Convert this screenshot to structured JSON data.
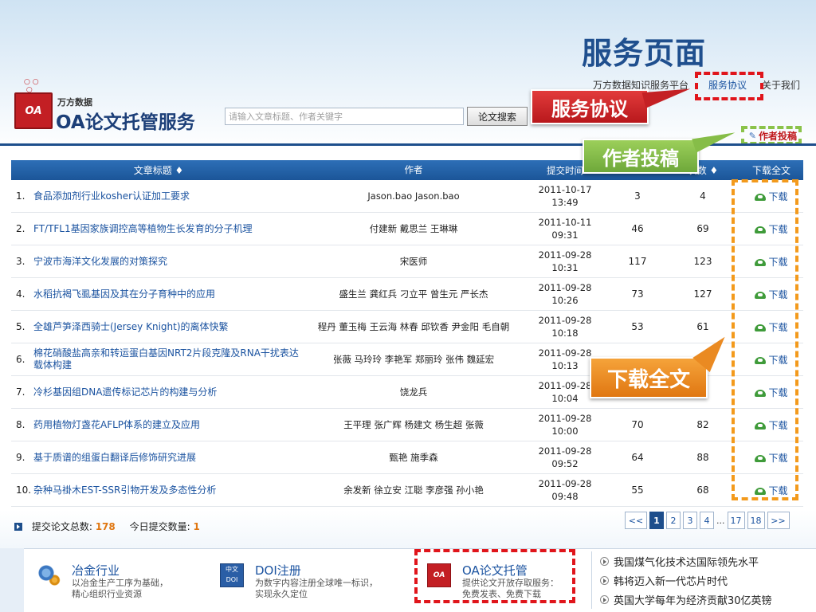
{
  "slide_title": "服务页面",
  "logo": {
    "brand": "万方数据",
    "badge": "OA",
    "name": "OA论文托管服务"
  },
  "search": {
    "placeholder": "请输入文章标题、作者关键字",
    "button_label": "论文搜索"
  },
  "top_links": {
    "platform": "万方数据知识服务平台",
    "agreement": "服务协议",
    "about": "关于我们"
  },
  "author_post_label": "作者投稿",
  "callouts": {
    "agreement": "服务协议",
    "author_post": "作者投稿",
    "download": "下载全文"
  },
  "table": {
    "headers": {
      "title": "文章标题 ♦",
      "author": "作者",
      "time": "提交时间",
      "views": "",
      "downloads": "次数 ♦",
      "download_full": "下载全文"
    },
    "download_label": "下载",
    "rows": [
      {
        "num": "1.",
        "title": "食品添加剂行业kosher认证加工要求",
        "authors": "Jason.bao  Jason.bao",
        "date": "2011-10-17",
        "time": "13:49",
        "views": "3",
        "downloads": "4"
      },
      {
        "num": "2.",
        "title": "FT/TFL1基因家族调控高等植物生长发育的分子机理",
        "authors": "付建新  戴思兰  王琳琳",
        "date": "2011-10-11",
        "time": "09:31",
        "views": "46",
        "downloads": "69"
      },
      {
        "num": "3.",
        "title": "宁波市海洋文化发展的对策探究",
        "authors": "宋医师",
        "date": "2011-09-28",
        "time": "10:31",
        "views": "117",
        "downloads": "123"
      },
      {
        "num": "4.",
        "title": "水稻抗褐飞虱基因及其在分子育种中的应用",
        "authors": "盛生兰  龚红兵  刁立平  曾生元  严长杰",
        "date": "2011-09-28",
        "time": "10:26",
        "views": "73",
        "downloads": "127"
      },
      {
        "num": "5.",
        "title": "全雄芦笋泽西骑士(Jersey Knight)的离体快繁",
        "authors": "程丹  董玉梅  王云海  林春  邱钦香  尹金阳  毛自朝",
        "date": "2011-09-28",
        "time": "10:18",
        "views": "53",
        "downloads": "61"
      },
      {
        "num": "6.",
        "title": "棉花硝酸盐高亲和转运蛋白基因NRT2片段克隆及RNA干扰表达载体构建",
        "authors": "张薇  马玲玲  李艳军  郑丽玲  张伟  魏延宏",
        "date": "2011-09-28",
        "time": "10:13",
        "views": "",
        "downloads": ""
      },
      {
        "num": "7.",
        "title": "冷杉基因组DNA遗传标记芯片的构建与分析",
        "authors": "饶龙兵",
        "date": "2011-09-28",
        "time": "10:04",
        "views": "",
        "downloads": ""
      },
      {
        "num": "8.",
        "title": "药用植物灯盏花AFLP体系的建立及应用",
        "authors": "王平理  张广辉  杨建文  杨生超  张薇",
        "date": "2011-09-28",
        "time": "10:00",
        "views": "70",
        "downloads": "82"
      },
      {
        "num": "9.",
        "title": "基于质谱的组蛋白翻译后修饰研究进展",
        "authors": "甄艳  施季森",
        "date": "2011-09-28",
        "time": "09:52",
        "views": "64",
        "downloads": "88"
      },
      {
        "num": "10.",
        "title": "杂种马褂木EST-SSR引物开发及多态性分析",
        "authors": "余发新  徐立安  江聪  李彦强  孙小艳",
        "date": "2011-09-28",
        "time": "09:48",
        "views": "55",
        "downloads": "68"
      }
    ]
  },
  "stats": {
    "total_label": "提交论文总数:",
    "total_value": "178",
    "today_label": "今日提交数量:",
    "today_value": "1"
  },
  "pagination": {
    "prev": "<<",
    "pages": [
      "1",
      "2",
      "3",
      "4"
    ],
    "ellipsis": "...",
    "tail_pages": [
      "17",
      "18"
    ],
    "next": ">>",
    "current": "1"
  },
  "services": [
    {
      "name": "冶金行业",
      "desc1": "以冶金生产工序为基础，",
      "desc2": "精心组织行业资源",
      "icon": "gear-icon"
    },
    {
      "name": "DOI注册",
      "desc1": "为数字内容注册全球唯一标识，",
      "desc2": "实现永久定位",
      "icon": "doi-icon",
      "icon_text": "中文 DOI"
    },
    {
      "name": "OA论文托管",
      "desc1": "提供论文开放存取服务：",
      "desc2": "免费发表、免费下载",
      "icon": "oa-icon",
      "icon_text": "OA"
    }
  ],
  "news": [
    "我国煤气化技术达国际领先水平",
    "韩将迈入新一代芯片时代",
    "英国大学每年为经济贡献30亿英镑"
  ],
  "colors": {
    "brand_blue": "#1d4e8c",
    "link_blue": "#1b53a0",
    "logo_red": "#c31f24",
    "callout_red": "#d02b2e",
    "callout_green": "#86bd48",
    "callout_orange": "#ea8a22"
  }
}
